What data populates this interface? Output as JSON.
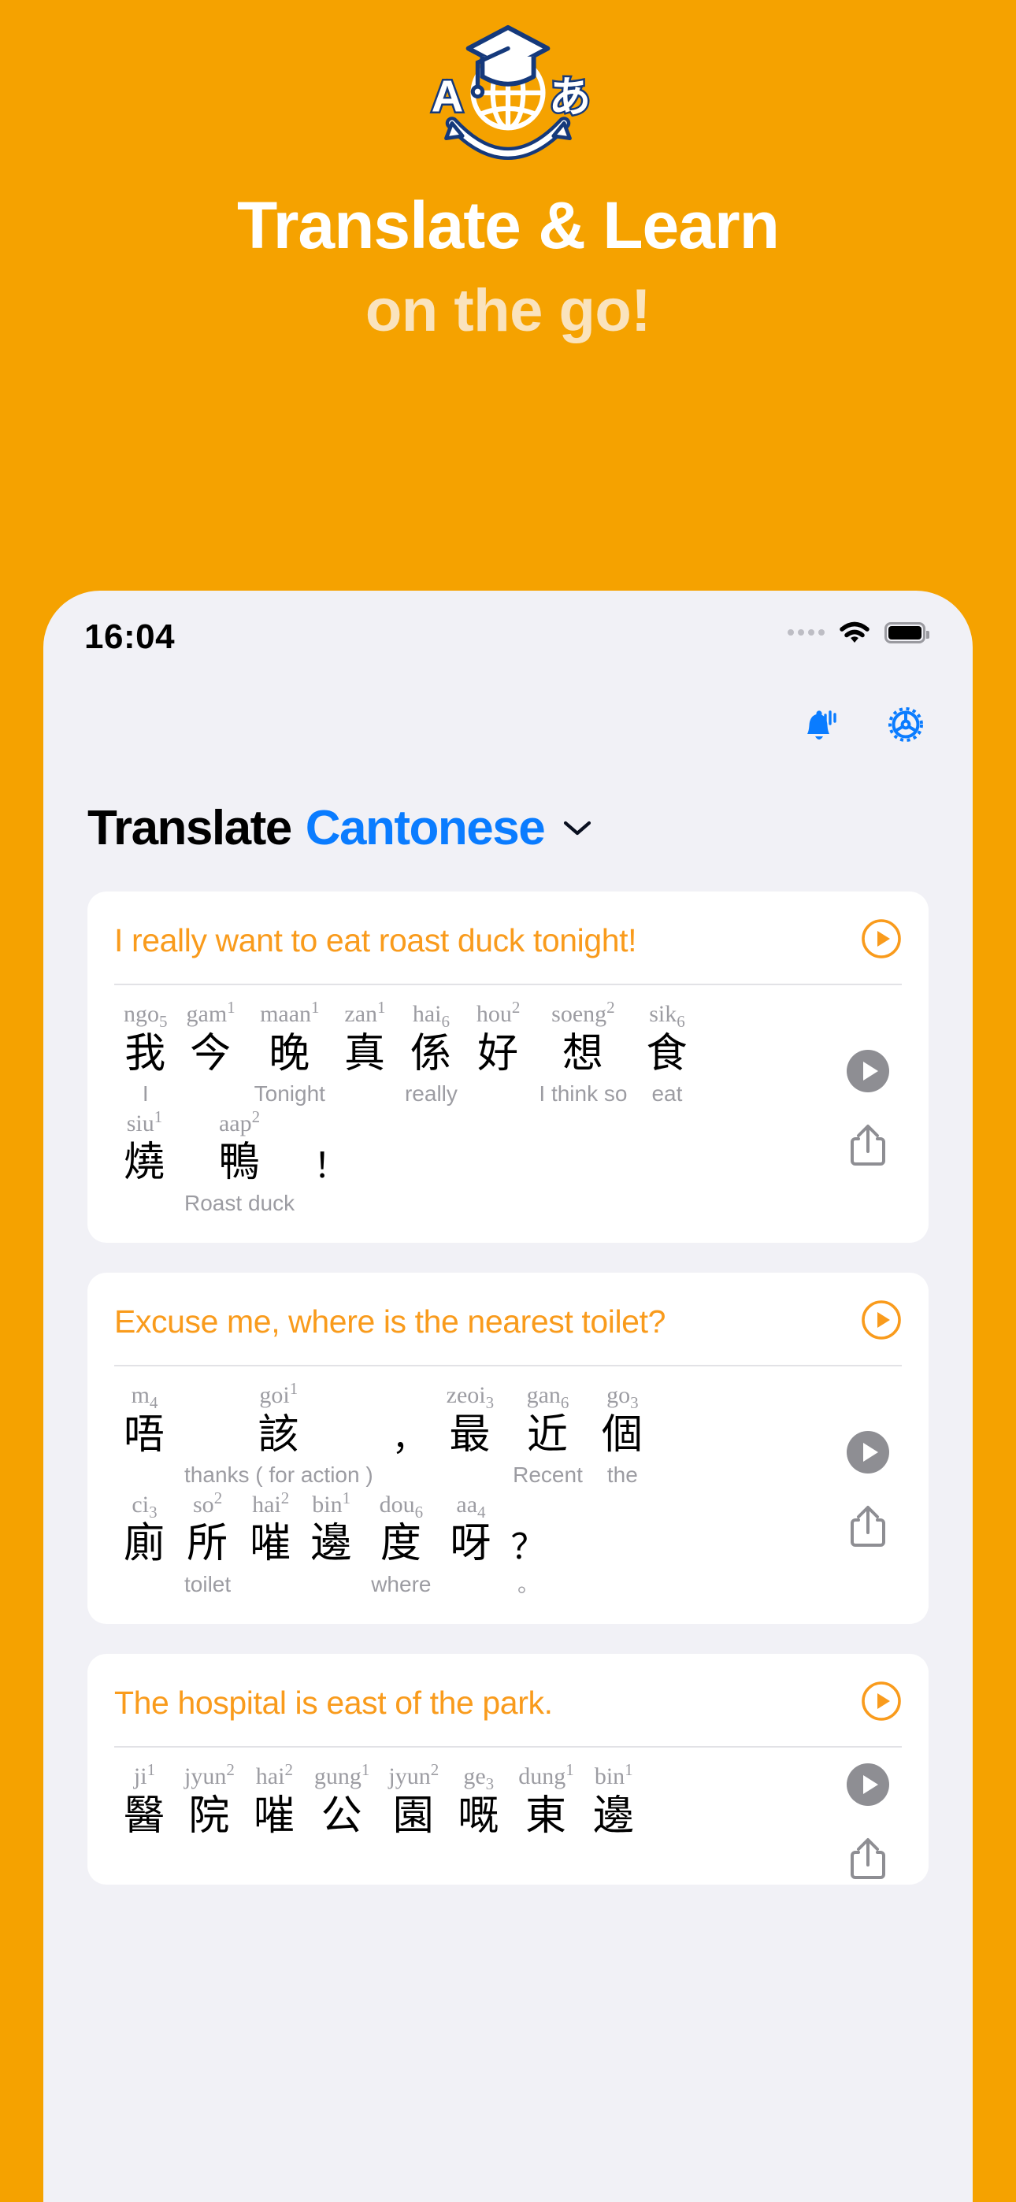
{
  "promo": {
    "logo_icon": "graduation-globe-translate-icon",
    "title": "Translate & Learn",
    "subtitle": "on the go!",
    "bg_color": "#F5A200",
    "title_color": "#FFFFFF",
    "subtitle_color": "#FAE3BD"
  },
  "statusbar": {
    "time": "16:04",
    "signal_icon": "signal-dots-icon",
    "wifi_icon": "wifi-icon",
    "battery_icon": "battery-full-icon"
  },
  "toolbar": {
    "notification_label": "notification-bell",
    "settings_label": "settings-gear"
  },
  "header": {
    "title_static": "Translate",
    "language": "Cantonese",
    "chevron": "chevron-down-icon",
    "language_color": "#0A7CFF"
  },
  "accent": {
    "orange": "#F99B1C",
    "gray": "#9C9CA2"
  },
  "cards": [
    {
      "phrase": "I really want to eat roast duck tonight!",
      "play_ring": "play-circle-outline-icon",
      "play_solid": "play-circle-filled-icon",
      "share": "share-icon",
      "rows": [
        [
          {
            "rom": "ngo",
            "tone": "5",
            "tone_pos": "sub",
            "han": "我",
            "gloss": "I"
          },
          {
            "rom": "gam",
            "tone": "1",
            "tone_pos": "sup",
            "han": "今",
            "gloss": ""
          },
          {
            "rom": "maan",
            "tone": "1",
            "tone_pos": "sup",
            "han": "晚",
            "gloss": "Tonight"
          },
          {
            "rom": "zan",
            "tone": "1",
            "tone_pos": "sup",
            "han": "真",
            "gloss": ""
          },
          {
            "rom": "hai",
            "tone": "6",
            "tone_pos": "sub",
            "han": "係",
            "gloss": "really"
          },
          {
            "rom": "hou",
            "tone": "2",
            "tone_pos": "sup",
            "han": "好",
            "gloss": ""
          },
          {
            "rom": "soeng",
            "tone": "2",
            "tone_pos": "sup",
            "han": "想",
            "gloss": "I think so"
          },
          {
            "rom": "sik",
            "tone": "6",
            "tone_pos": "sub",
            "han": "食",
            "gloss": "eat"
          }
        ],
        [
          {
            "rom": "siu",
            "tone": "1",
            "tone_pos": "sup",
            "han": "燒",
            "gloss": ""
          },
          {
            "rom": "aap",
            "tone": "2",
            "tone_pos": "sup",
            "han": "鴨",
            "gloss": "Roast duck"
          },
          {
            "rom": "",
            "tone": "",
            "tone_pos": "sup",
            "han": "！",
            "gloss": ""
          }
        ]
      ]
    },
    {
      "phrase": "Excuse me, where is the nearest toilet?",
      "play_ring": "play-circle-outline-icon",
      "play_solid": "play-circle-filled-icon",
      "share": "share-icon",
      "rows": [
        [
          {
            "rom": "m",
            "tone": "4",
            "tone_pos": "sub",
            "han": "唔",
            "gloss": ""
          },
          {
            "rom": "goi",
            "tone": "1",
            "tone_pos": "sup",
            "han": "該",
            "gloss": "thanks ( for action )"
          },
          {
            "rom": "",
            "tone": "",
            "tone_pos": "sup",
            "han": "，",
            "gloss": ""
          },
          {
            "rom": "zeoi",
            "tone": "3",
            "tone_pos": "sub",
            "han": "最",
            "gloss": ""
          },
          {
            "rom": "gan",
            "tone": "6",
            "tone_pos": "sub",
            "han": "近",
            "gloss": "Recent"
          },
          {
            "rom": "go",
            "tone": "3",
            "tone_pos": "sub",
            "han": "個",
            "gloss": "the"
          }
        ],
        [
          {
            "rom": "ci",
            "tone": "3",
            "tone_pos": "sub",
            "han": "廁",
            "gloss": ""
          },
          {
            "rom": "so",
            "tone": "2",
            "tone_pos": "sup",
            "han": "所",
            "gloss": "toilet"
          },
          {
            "rom": "hai",
            "tone": "2",
            "tone_pos": "sup",
            "han": "嗺",
            "gloss": ""
          },
          {
            "rom": "bin",
            "tone": "1",
            "tone_pos": "sup",
            "han": "邊",
            "gloss": ""
          },
          {
            "rom": "dou",
            "tone": "6",
            "tone_pos": "sub",
            "han": "度",
            "gloss": "where"
          },
          {
            "rom": "aa",
            "tone": "4",
            "tone_pos": "sub",
            "han": "呀",
            "gloss": ""
          },
          {
            "rom": "",
            "tone": "",
            "tone_pos": "sup",
            "han": "？",
            "gloss": "。"
          }
        ]
      ]
    },
    {
      "phrase": "The hospital is east of the park.",
      "play_ring": "play-circle-outline-icon",
      "play_solid": "play-circle-filled-icon",
      "share": "share-icon",
      "rows": [
        [
          {
            "rom": "ji",
            "tone": "1",
            "tone_pos": "sup",
            "han": "醫",
            "gloss": ""
          },
          {
            "rom": "jyun",
            "tone": "2",
            "tone_pos": "sup",
            "han": "院",
            "gloss": ""
          },
          {
            "rom": "hai",
            "tone": "2",
            "tone_pos": "sup",
            "han": "嗺",
            "gloss": ""
          },
          {
            "rom": "gung",
            "tone": "1",
            "tone_pos": "sup",
            "han": "公",
            "gloss": ""
          },
          {
            "rom": "jyun",
            "tone": "2",
            "tone_pos": "sup",
            "han": "園",
            "gloss": ""
          },
          {
            "rom": "ge",
            "tone": "3",
            "tone_pos": "sub",
            "han": "嘅",
            "gloss": ""
          },
          {
            "rom": "dung",
            "tone": "1",
            "tone_pos": "sup",
            "han": "東",
            "gloss": ""
          },
          {
            "rom": "bin",
            "tone": "1",
            "tone_pos": "sup",
            "han": "邊",
            "gloss": ""
          }
        ]
      ]
    }
  ]
}
